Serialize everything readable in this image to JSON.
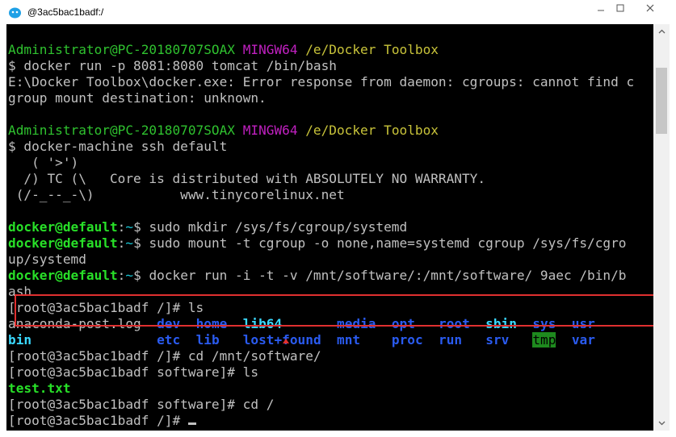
{
  "window": {
    "title": "@3ac5bac1badf:/",
    "minimize_label": "minimize",
    "maximize_label": "maximize",
    "close_label": "close"
  },
  "terminal": {
    "lines": [
      {
        "segments": [
          {
            "t": "Administrator@PC-20180707SOAX",
            "c": "green"
          },
          {
            "t": " ",
            "c": ""
          },
          {
            "t": "MINGW64",
            "c": "purple"
          },
          {
            "t": " ",
            "c": ""
          },
          {
            "t": "/e/Docker Toolbox",
            "c": "yellow"
          }
        ]
      },
      {
        "segments": [
          {
            "t": "$ docker run -p 8081:8080 tomcat /bin/bash",
            "c": ""
          }
        ]
      },
      {
        "segments": [
          {
            "t": "E:\\Docker Toolbox\\docker.exe: Error response from daemon: cgroups: cannot find c",
            "c": ""
          }
        ]
      },
      {
        "segments": [
          {
            "t": "group mount destination: unknown.",
            "c": ""
          }
        ]
      },
      {
        "segments": [
          {
            "t": "",
            "c": ""
          }
        ]
      },
      {
        "segments": [
          {
            "t": "Administrator@PC-20180707SOAX",
            "c": "green"
          },
          {
            "t": " ",
            "c": ""
          },
          {
            "t": "MINGW64",
            "c": "purple"
          },
          {
            "t": " ",
            "c": ""
          },
          {
            "t": "/e/Docker Toolbox",
            "c": "yellow"
          }
        ]
      },
      {
        "segments": [
          {
            "t": "$ docker-machine ssh default",
            "c": ""
          }
        ]
      },
      {
        "segments": [
          {
            "t": "   ( '>')",
            "c": ""
          }
        ]
      },
      {
        "segments": [
          {
            "t": "  /) TC (\\   Core is distributed with ABSOLUTELY NO WARRANTY.",
            "c": ""
          }
        ]
      },
      {
        "segments": [
          {
            "t": " (/-_--_-\\)           www.tinycorelinux.net",
            "c": ""
          }
        ]
      },
      {
        "segments": [
          {
            "t": "",
            "c": ""
          }
        ]
      },
      {
        "segments": [
          {
            "t": "docker@default",
            "c": "bgreen"
          },
          {
            "t": ":",
            "c": ""
          },
          {
            "t": "~",
            "c": "cyan"
          },
          {
            "t": "$ sudo mkdir /sys/fs/cgroup/systemd",
            "c": ""
          }
        ]
      },
      {
        "segments": [
          {
            "t": "docker@default",
            "c": "bgreen"
          },
          {
            "t": ":",
            "c": ""
          },
          {
            "t": "~",
            "c": "cyan"
          },
          {
            "t": "$ sudo mount -t cgroup -o none,name=systemd cgroup /sys/fs/cgro",
            "c": ""
          }
        ]
      },
      {
        "segments": [
          {
            "t": "up/systemd",
            "c": ""
          }
        ]
      },
      {
        "segments": [
          {
            "t": "docker@default",
            "c": "bgreen"
          },
          {
            "t": ":",
            "c": ""
          },
          {
            "t": "~",
            "c": "cyan"
          },
          {
            "t": "$ docker run -i -t -v /mnt/software/:/mnt/software/ 9aec /bin/b",
            "c": ""
          }
        ]
      },
      {
        "segments": [
          {
            "t": "ash",
            "c": ""
          }
        ]
      },
      {
        "segments": [
          {
            "t": "[root@3ac5bac1badf /]# ls",
            "c": ""
          }
        ]
      },
      {
        "segments": [
          {
            "t": "anaconda-post.log  ",
            "c": ""
          },
          {
            "t": "dev",
            "c": "blue"
          },
          {
            "t": "  ",
            "c": ""
          },
          {
            "t": "home",
            "c": "blue"
          },
          {
            "t": "  ",
            "c": ""
          },
          {
            "t": "lib64",
            "c": "bcyan"
          },
          {
            "t": "       ",
            "c": ""
          },
          {
            "t": "media",
            "c": "blue"
          },
          {
            "t": "  ",
            "c": ""
          },
          {
            "t": "opt",
            "c": "blue"
          },
          {
            "t": "   ",
            "c": ""
          },
          {
            "t": "root",
            "c": "blue"
          },
          {
            "t": "  ",
            "c": ""
          },
          {
            "t": "sbin",
            "c": "bcyan"
          },
          {
            "t": "  ",
            "c": ""
          },
          {
            "t": "sys",
            "c": "blue"
          },
          {
            "t": "  ",
            "c": ""
          },
          {
            "t": "usr",
            "c": "blue"
          }
        ]
      },
      {
        "segments": [
          {
            "t": "bin",
            "c": "bcyan"
          },
          {
            "t": "                ",
            "c": ""
          },
          {
            "t": "etc",
            "c": "blue"
          },
          {
            "t": "  ",
            "c": ""
          },
          {
            "t": "lib",
            "c": "blue"
          },
          {
            "t": "   ",
            "c": ""
          },
          {
            "t": "lost+found",
            "c": "blue"
          },
          {
            "t": "  ",
            "c": ""
          },
          {
            "t": "mnt",
            "c": "blue"
          },
          {
            "t": "    ",
            "c": ""
          },
          {
            "t": "proc",
            "c": "blue"
          },
          {
            "t": "  ",
            "c": ""
          },
          {
            "t": "run",
            "c": "blue"
          },
          {
            "t": "   ",
            "c": ""
          },
          {
            "t": "srv",
            "c": "blue"
          },
          {
            "t": "   ",
            "c": ""
          },
          {
            "t": "tmp",
            "c": "tmp"
          },
          {
            "t": "  ",
            "c": ""
          },
          {
            "t": "var",
            "c": "blue"
          }
        ]
      },
      {
        "segments": [
          {
            "t": "[root@3ac5bac1badf /]# cd /mnt/software/",
            "c": ""
          }
        ]
      },
      {
        "segments": [
          {
            "t": "[root@3ac5bac1badf software]# ls",
            "c": ""
          }
        ]
      },
      {
        "segments": [
          {
            "t": "test.txt",
            "c": "bgreen"
          }
        ]
      },
      {
        "segments": [
          {
            "t": "[root@3ac5bac1badf software]# cd /",
            "c": ""
          }
        ]
      },
      {
        "segments": [
          {
            "t": "[root@3ac5bac1badf /]# ",
            "c": ""
          }
        ]
      }
    ]
  },
  "colors": {
    "terminal_bg": "#000000",
    "default_text": "#c0c0c0",
    "highlight_border": "#e03030"
  }
}
